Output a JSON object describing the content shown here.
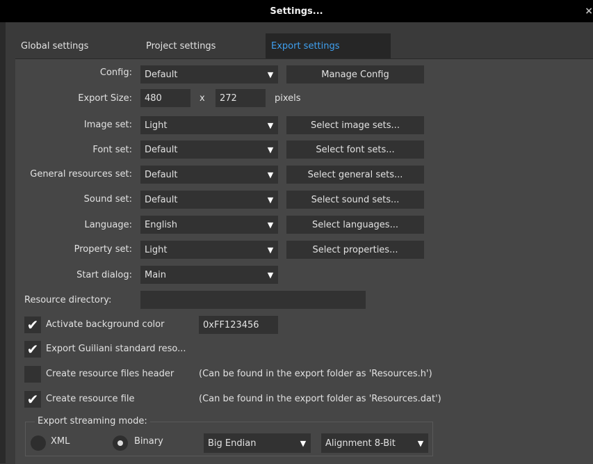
{
  "window": {
    "title": "Settings...",
    "close_glyph": "×"
  },
  "tabs": [
    {
      "label": "Global settings"
    },
    {
      "label": "Project settings"
    },
    {
      "label": "Export settings"
    }
  ],
  "config": {
    "label": "Config:",
    "value": "Default",
    "button": "Manage Config"
  },
  "export_size": {
    "label": "Export Size:",
    "width": "480",
    "sep": "x",
    "height": "272",
    "unit": "pixels"
  },
  "image_set": {
    "label": "Image set:",
    "value": "Light",
    "button": "Select image sets..."
  },
  "font_set": {
    "label": "Font set:",
    "value": "Default",
    "button": "Select font sets..."
  },
  "general_set": {
    "label": "General resources set:",
    "value": "Default",
    "button": "Select general sets..."
  },
  "sound_set": {
    "label": "Sound set:",
    "value": "Default",
    "button": "Select sound sets..."
  },
  "language": {
    "label": "Language:",
    "value": "English",
    "button": "Select languages..."
  },
  "property_set": {
    "label": "Property set:",
    "value": "Light",
    "button": "Select properties..."
  },
  "start_dialog": {
    "label": "Start dialog:",
    "value": "Main"
  },
  "resource_directory": {
    "label": "Resource directory:",
    "value": ""
  },
  "checks": {
    "background": {
      "label": "Activate background color",
      "checked": true,
      "value": "0xFF123456"
    },
    "guiliani": {
      "label": "Export Guiliani standard reso...",
      "checked": true
    },
    "header": {
      "label": "Create resource files header",
      "checked": false,
      "note": "(Can be found in the export folder as 'Resources.h')"
    },
    "resfile": {
      "label": "Create resource file",
      "checked": true,
      "note": "(Can be found in the export folder as 'Resources.dat')"
    }
  },
  "streaming": {
    "title": "Export streaming mode:",
    "xml": "XML",
    "binary": "Binary",
    "selected": "Binary",
    "endian": "Big Endian",
    "alignment": "Alignment 8-Bit"
  },
  "icons": {
    "check": "✔",
    "arrow": "▼"
  }
}
